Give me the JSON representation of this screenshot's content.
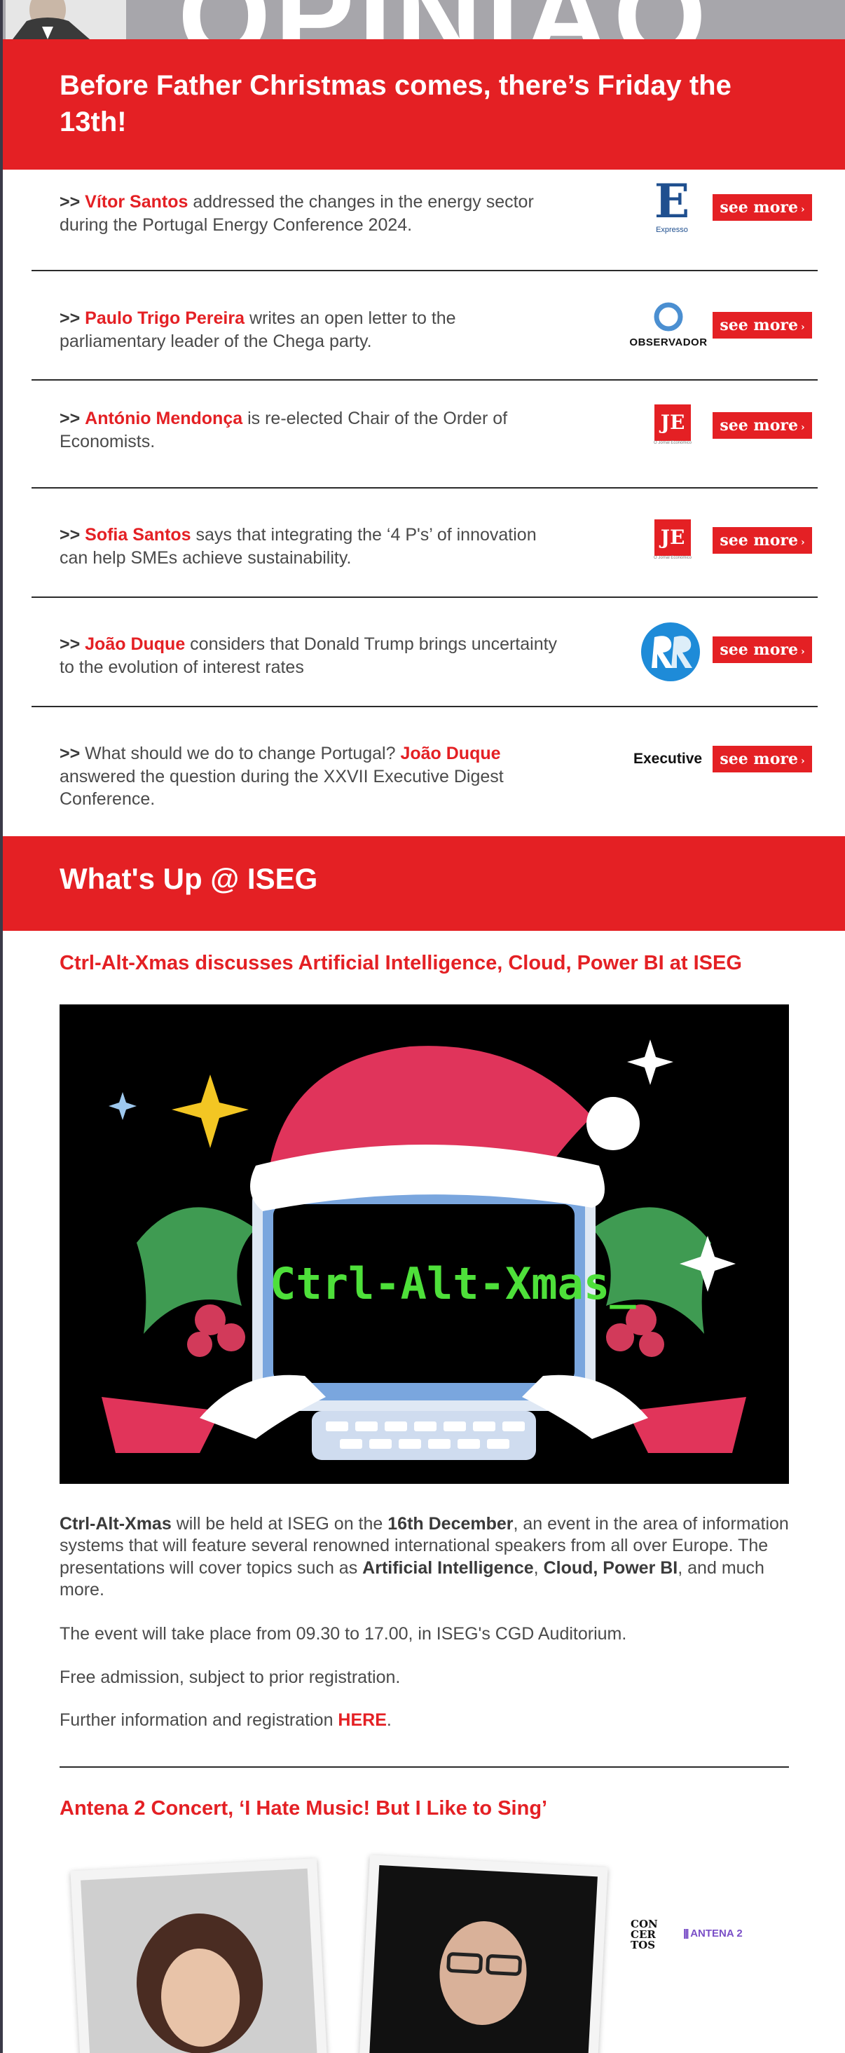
{
  "banner": {
    "word": "OPINIÃO"
  },
  "hero": {
    "title": "Before Father Christmas comes, there’s Friday the 13th!"
  },
  "opinions": [
    {
      "arrows": ">>",
      "name": "Vítor Santos",
      "before": "",
      "after": " addressed the changes in the energy sector during the Portugal Energy Conference 2024.",
      "logo": "expresso-logo",
      "logo_text": "E",
      "logo_sub": "Expresso",
      "button": "see more",
      "arrow_glyph": "›"
    },
    {
      "arrows": ">>",
      "name": "Paulo Trigo Pereira",
      "before": "",
      "after": " writes an open letter to the parliamentary leader of the Chega party.",
      "logo": "observador-logo",
      "logo_text": "OBSERVADOR",
      "button": "see more",
      "arrow_glyph": "›"
    },
    {
      "arrows": ">>",
      "name": "António Mendonça",
      "before": "",
      "after": " is re-elected Chair of the Order of Economists.",
      "logo": "jornal-economico-logo",
      "logo_text": "JE",
      "logo_sub": "O Jornal Económico",
      "button": "see more",
      "arrow_glyph": "›"
    },
    {
      "arrows": ">>",
      "name": "Sofia Santos",
      "before": "",
      "after": " says that integrating the ‘4 P's’ of innovation can help SMEs achieve sustainability.",
      "logo": "jornal-economico-logo",
      "logo_text": "JE",
      "logo_sub": "O Jornal Económico",
      "button": "see more",
      "arrow_glyph": "›"
    },
    {
      "arrows": ">>",
      "name": "João Duque",
      "before": "",
      "after": " considers that Donald Trump brings uncertainty to the evolution of interest rates",
      "logo": "rr-logo",
      "logo_text": "RR",
      "button": "see more",
      "arrow_glyph": "›"
    },
    {
      "arrows": ">>",
      "name": "João Duque",
      "before": " What should we do to change Portugal? ",
      "after": " answered the question during the XXVII Executive Digest Conference.",
      "logo": "executive-logo",
      "logo_text": "Executive",
      "button": "see more",
      "arrow_glyph": "›"
    }
  ],
  "whatsup": {
    "title": "What's Up @ ISEG"
  },
  "event1": {
    "title": "Ctrl-Alt-Xmas discusses Artificial Intelligence, Cloud, Power BI at ISEG",
    "image_text": "Ctrl-Alt-Xmas_",
    "p1_a": "Ctrl-Alt-Xmas",
    "p1_b": " will be held at ISEG on the ",
    "p1_c": "16th December",
    "p1_d": ", an event in the area of information systems that will feature several renowned international speakers from all over Europe. The presentations will cover topics such as ",
    "p1_e": "Artificial Intelligence",
    "p1_f": ", ",
    "p1_g": "Cloud, Power BI",
    "p1_h": ", and much more.",
    "p2": "The event will take place from 09.30 to 17.00, in ISEG's CGD Auditorium.",
    "p3": "Free admission, subject to prior registration.",
    "p4_a": "Further information and registration ",
    "p4_link": "HERE",
    "p4_b": "."
  },
  "event2": {
    "title": "Antena 2 Concert, ‘I Hate Music! But I Like to Sing’",
    "concertos_text": "CON CER TOS",
    "antena_text": "ANTENA 2"
  },
  "colors": {
    "brand_red": "#e42024",
    "text_grey": "#4a4a4a"
  }
}
